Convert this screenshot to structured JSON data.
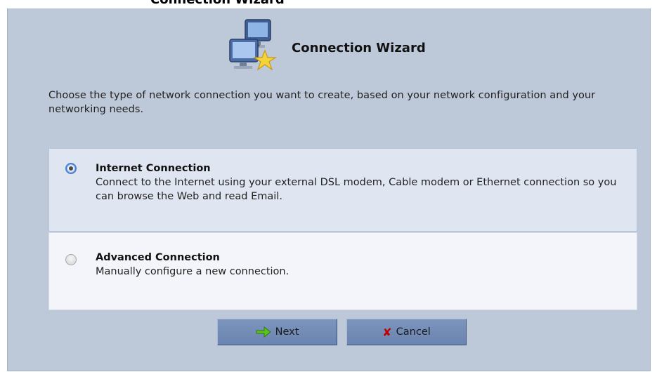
{
  "header": {
    "top_text": "Connection Wizard",
    "title": "Connection Wizard",
    "icon": "connection-wizard-icon"
  },
  "intro": "Choose the type of network connection you want to create, based on your network configuration and your networking needs.",
  "options": [
    {
      "title": "Internet Connection",
      "description": "Connect to the Internet using your external DSL modem, Cable modem or Ethernet connection so you can browse the Web and read Email.",
      "selected": true
    },
    {
      "title": "Advanced Connection",
      "description": "Manually configure a new connection.",
      "selected": false
    }
  ],
  "buttons": {
    "next_label": "Next",
    "cancel_label": "Cancel"
  },
  "colors": {
    "panel_bg": "#bdc8d9",
    "selected_option_bg": "#dfe6f2",
    "unselected_option_bg": "#f3f5fa",
    "button_bg": "#7590b8",
    "cancel_icon": "#c00000",
    "next_icon": "#4caf1a"
  }
}
